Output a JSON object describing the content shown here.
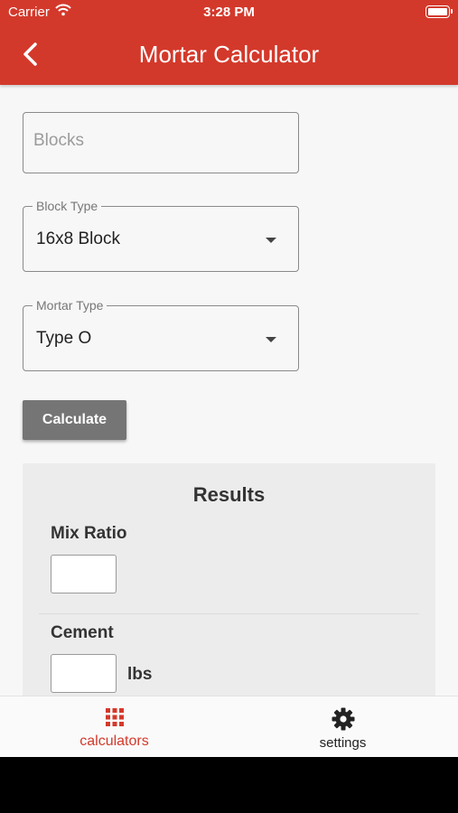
{
  "status_bar": {
    "carrier": "Carrier",
    "time": "3:28 PM"
  },
  "header": {
    "title": "Mortar Calculator",
    "back_icon": "chevron-left-icon"
  },
  "form": {
    "blocks": {
      "placeholder": "Blocks",
      "value": ""
    },
    "block_type": {
      "label": "Block Type",
      "selected": "16x8 Block"
    },
    "mortar_type": {
      "label": "Mortar Type",
      "selected": "Type O"
    },
    "calculate_label": "Calculate"
  },
  "results": {
    "title": "Results",
    "mix_ratio": {
      "label": "Mix Ratio",
      "value": ""
    },
    "cement": {
      "label": "Cement",
      "value": "",
      "unit": "lbs"
    }
  },
  "tabs": [
    {
      "label": "calculators",
      "icon": "grid-icon",
      "active": true
    },
    {
      "label": "settings",
      "icon": "gear-icon",
      "active": false
    }
  ],
  "colors": {
    "accent": "#d3392b",
    "button": "#757575",
    "results_bg": "#ececec"
  }
}
